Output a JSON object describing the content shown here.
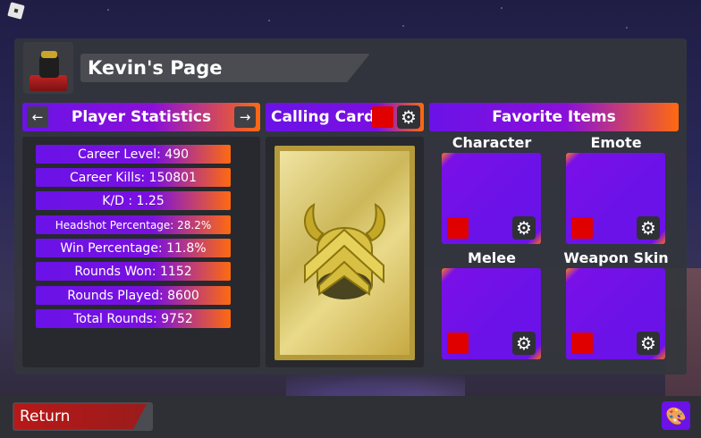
{
  "page": {
    "title": "Kevin's Page"
  },
  "stats_panel": {
    "title": "Player Statistics",
    "prev_glyph": "←",
    "next_glyph": "→",
    "rows": [
      "Career Level: 490",
      "Career Kills: 150801",
      "K/D : 1.25",
      "Headshot Percentage: 28.2%",
      "Win Percentage: 11.8%",
      "Rounds Won: 1152",
      "Rounds Played: 8600",
      "Total Rounds: 9752"
    ]
  },
  "calling_card": {
    "title": "Calling Card",
    "swatch_color": "#e00000",
    "gear_glyph": "⚙",
    "art_icon": "golden-horned-helmet-icon"
  },
  "favorites": {
    "title": "Favorite Items",
    "slots": [
      {
        "label": "Character",
        "swatch_color": "#e00000",
        "gear_glyph": "⚙"
      },
      {
        "label": "Emote",
        "swatch_color": "#e00000",
        "gear_glyph": "⚙"
      },
      {
        "label": "Melee",
        "swatch_color": "#e00000",
        "gear_glyph": "⚙"
      },
      {
        "label": "Weapon Skin",
        "swatch_color": "#e00000",
        "gear_glyph": "⚙"
      }
    ]
  },
  "footer": {
    "return_label": "Return",
    "palette_glyph": "🎨"
  },
  "colors": {
    "accent_purple": "#6a12e8",
    "accent_orange": "#ff6a10",
    "panel_bg": "#34363c",
    "return_red": "#b81818"
  }
}
